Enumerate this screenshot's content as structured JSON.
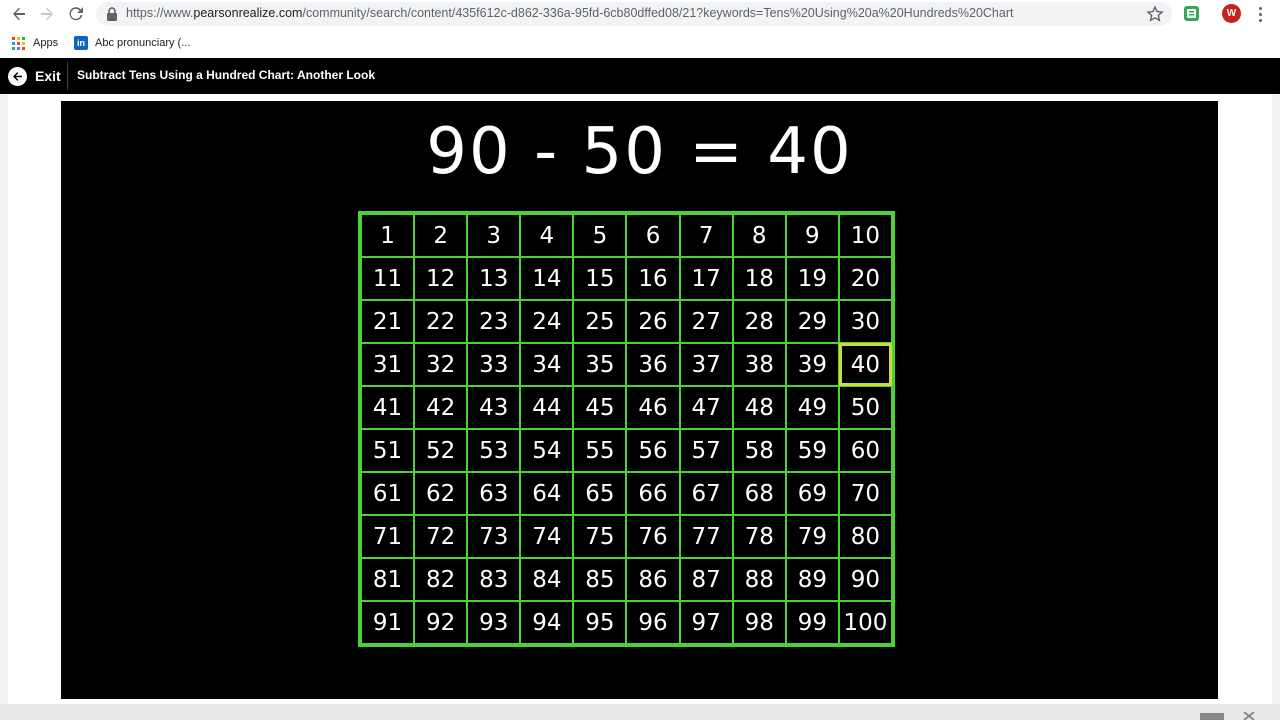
{
  "browser": {
    "url_prefix": "https://www.",
    "url_host": "pearsonrealize.com",
    "url_path": "/community/search/content/435f612c-d862-336a-95fd-6cb80dffed08/21?keywords=Tens%20Using%20a%20Hundreds%20Chart",
    "profile_initial": "W",
    "profile_color": "#c5221f",
    "icons": [
      "back-arrow-icon",
      "forward-arrow-icon",
      "reload-icon",
      "lock-icon",
      "star-icon",
      "extension-icon",
      "menu-kebab-icon"
    ]
  },
  "bookmarks": {
    "apps_label": "Apps",
    "item1_label": "Abc pronunciary (..."
  },
  "header": {
    "exit_label": "Exit",
    "title": "Subtract Tens Using a Hundred Chart: Another Look"
  },
  "video": {
    "equation": "90 - 50 = 40",
    "highlighted": "40",
    "grid_color": "#4cd137",
    "highlight_color": "#cddc39",
    "cells": [
      "1",
      "2",
      "3",
      "4",
      "5",
      "6",
      "7",
      "8",
      "9",
      "10",
      "11",
      "12",
      "13",
      "14",
      "15",
      "16",
      "17",
      "18",
      "19",
      "20",
      "21",
      "22",
      "23",
      "24",
      "25",
      "26",
      "27",
      "28",
      "29",
      "30",
      "31",
      "32",
      "33",
      "34",
      "35",
      "36",
      "37",
      "38",
      "39",
      "40",
      "41",
      "42",
      "43",
      "44",
      "45",
      "46",
      "47",
      "48",
      "49",
      "50",
      "51",
      "52",
      "53",
      "54",
      "55",
      "56",
      "57",
      "58",
      "59",
      "60",
      "61",
      "62",
      "63",
      "64",
      "65",
      "66",
      "67",
      "68",
      "69",
      "70",
      "71",
      "72",
      "73",
      "74",
      "75",
      "76",
      "77",
      "78",
      "79",
      "80",
      "81",
      "82",
      "83",
      "84",
      "85",
      "86",
      "87",
      "88",
      "89",
      "90",
      "91",
      "92",
      "93",
      "94",
      "95",
      "96",
      "97",
      "98",
      "99",
      "100"
    ]
  }
}
